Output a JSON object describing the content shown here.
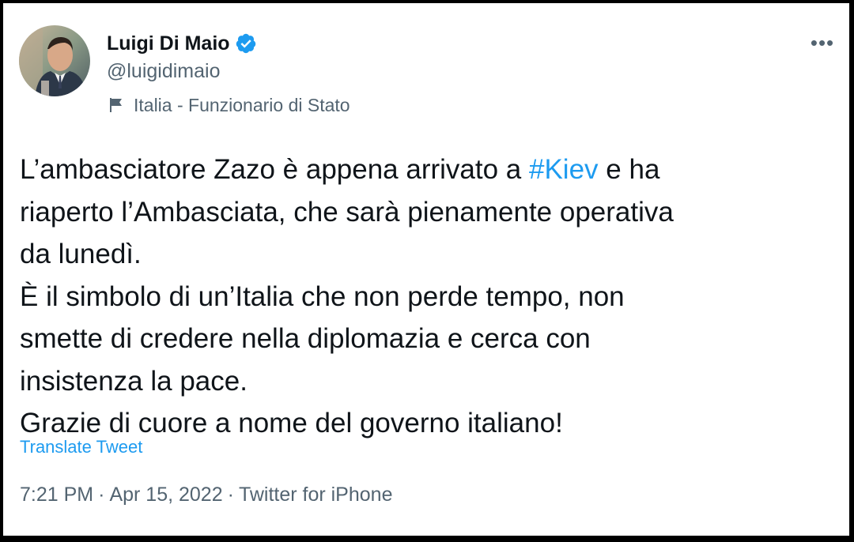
{
  "author": {
    "display_name": "Luigi Di Maio",
    "handle": "@luigidimaio",
    "verified": true,
    "avatar_icon": "profile-photo",
    "label_icon": "flag-icon",
    "label": "Italia - Funzionario di Stato"
  },
  "menu": {
    "more_icon": "more-horizontal-icon",
    "more_glyph": "•••"
  },
  "tweet": {
    "line1_pre": "L’ambasciatore Zazo è appena arrivato a ",
    "hashtag": "#Kiev",
    "line1_post": " e ha",
    "line2": "riaperto l’Ambasciata, che sarà pienamente operativa",
    "line3": "da lunedì.",
    "line4": "È il simbolo di un’Italia che non perde tempo, non",
    "line5": "smette di credere nella diplomazia e cerca con",
    "line6": "insistenza la pace.",
    "line7": "Grazie di cuore a nome del governo italiano!"
  },
  "translate_label": "Translate Tweet",
  "meta": {
    "time": "7:21 PM",
    "separator": "·",
    "date": "Apr 15, 2022",
    "source": "Twitter for iPhone"
  },
  "colors": {
    "link": "#1d9bf0",
    "secondary_text": "#536471",
    "primary_text": "#0f1419",
    "frame": "#000000"
  }
}
